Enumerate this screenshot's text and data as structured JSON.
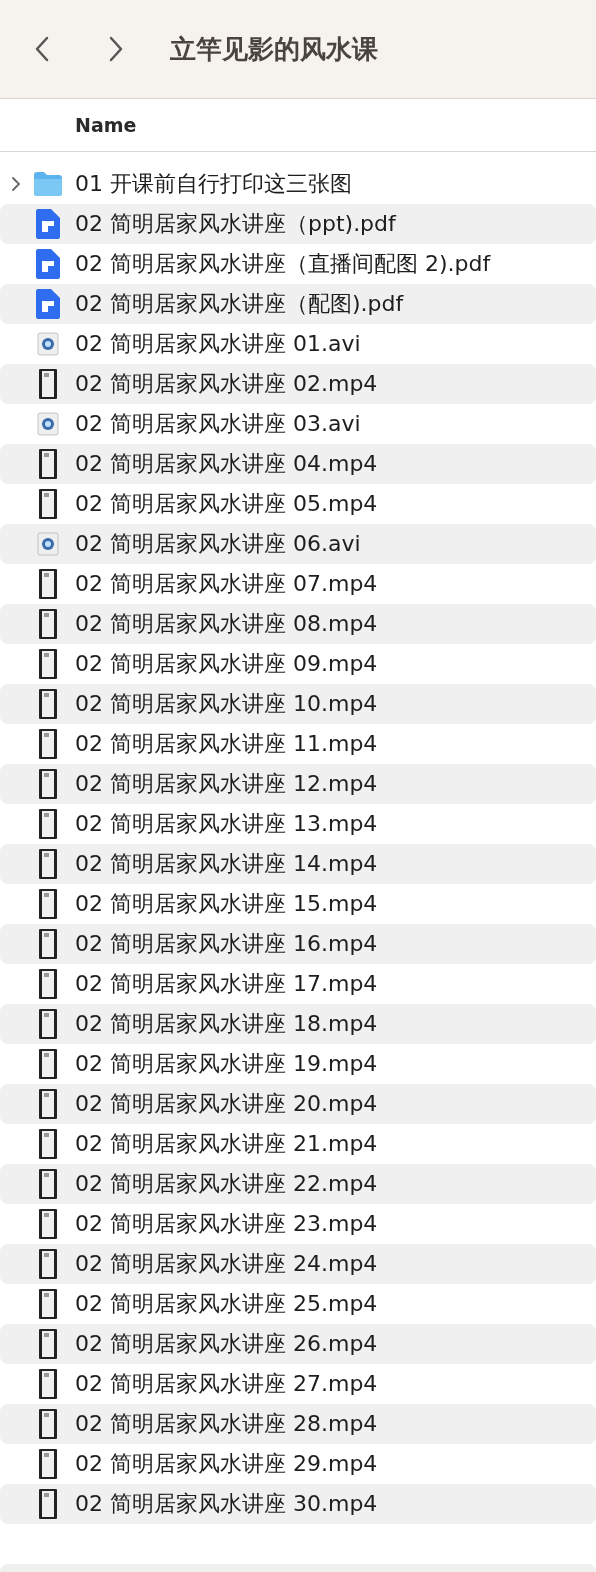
{
  "window": {
    "title": "立竿见影的风水课"
  },
  "table": {
    "columns": [
      "Name"
    ],
    "rows": [
      {
        "kind": "folder",
        "name": "01 开课前自行打印这三张图",
        "expanded": false
      },
      {
        "kind": "pdf",
        "name": "02 简明居家风水讲座（ppt).pdf"
      },
      {
        "kind": "pdf",
        "name": "02 简明居家风水讲座（直播间配图 2).pdf"
      },
      {
        "kind": "pdf",
        "name": "02 简明居家风水讲座（配图).pdf"
      },
      {
        "kind": "avi",
        "name": "02 简明居家风水讲座 01.avi"
      },
      {
        "kind": "mp4",
        "name": "02 简明居家风水讲座 02.mp4"
      },
      {
        "kind": "avi",
        "name": "02 简明居家风水讲座 03.avi"
      },
      {
        "kind": "mp4",
        "name": "02 简明居家风水讲座 04.mp4"
      },
      {
        "kind": "mp4",
        "name": "02 简明居家风水讲座 05.mp4"
      },
      {
        "kind": "avi",
        "name": "02 简明居家风水讲座 06.avi"
      },
      {
        "kind": "mp4",
        "name": "02 简明居家风水讲座 07.mp4"
      },
      {
        "kind": "mp4",
        "name": "02 简明居家风水讲座 08.mp4"
      },
      {
        "kind": "mp4",
        "name": "02 简明居家风水讲座 09.mp4"
      },
      {
        "kind": "mp4",
        "name": "02 简明居家风水讲座 10.mp4"
      },
      {
        "kind": "mp4",
        "name": "02 简明居家风水讲座 11.mp4"
      },
      {
        "kind": "mp4",
        "name": "02 简明居家风水讲座 12.mp4"
      },
      {
        "kind": "mp4",
        "name": "02 简明居家风水讲座 13.mp4"
      },
      {
        "kind": "mp4",
        "name": "02 简明居家风水讲座 14.mp4"
      },
      {
        "kind": "mp4",
        "name": "02 简明居家风水讲座 15.mp4"
      },
      {
        "kind": "mp4",
        "name": "02 简明居家风水讲座 16.mp4"
      },
      {
        "kind": "mp4",
        "name": "02 简明居家风水讲座 17.mp4"
      },
      {
        "kind": "mp4",
        "name": "02 简明居家风水讲座 18.mp4"
      },
      {
        "kind": "mp4",
        "name": "02 简明居家风水讲座 19.mp4"
      },
      {
        "kind": "mp4",
        "name": "02 简明居家风水讲座 20.mp4"
      },
      {
        "kind": "mp4",
        "name": "02 简明居家风水讲座 21.mp4"
      },
      {
        "kind": "mp4",
        "name": "02 简明居家风水讲座 22.mp4"
      },
      {
        "kind": "mp4",
        "name": "02 简明居家风水讲座 23.mp4"
      },
      {
        "kind": "mp4",
        "name": "02 简明居家风水讲座 24.mp4"
      },
      {
        "kind": "mp4",
        "name": "02 简明居家风水讲座 25.mp4"
      },
      {
        "kind": "mp4",
        "name": "02 简明居家风水讲座 26.mp4"
      },
      {
        "kind": "mp4",
        "name": "02 简明居家风水讲座 27.mp4"
      },
      {
        "kind": "mp4",
        "name": "02 简明居家风水讲座 28.mp4"
      },
      {
        "kind": "mp4",
        "name": "02 简明居家风水讲座 29.mp4"
      },
      {
        "kind": "mp4",
        "name": "02 简明居家风水讲座 30.mp4"
      }
    ]
  }
}
